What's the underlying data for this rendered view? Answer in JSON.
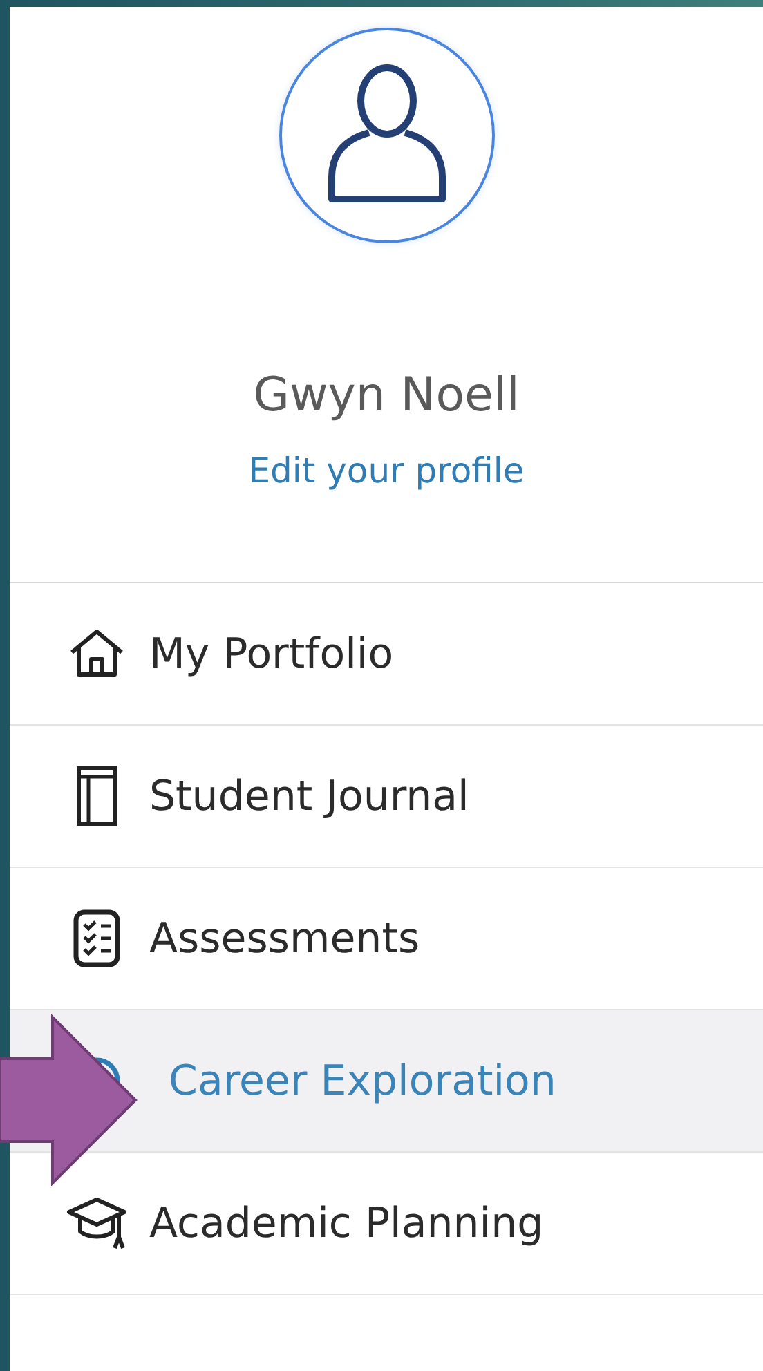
{
  "profile": {
    "name": "Gwyn Noell",
    "edit_link": "Edit your profile"
  },
  "menu": [
    {
      "label": "My Portfolio",
      "selected": false
    },
    {
      "label": "Student Journal",
      "selected": false
    },
    {
      "label": "Assessments",
      "selected": false
    },
    {
      "label": "Career Exploration",
      "selected": true
    },
    {
      "label": "Academic Planning",
      "selected": false
    }
  ]
}
